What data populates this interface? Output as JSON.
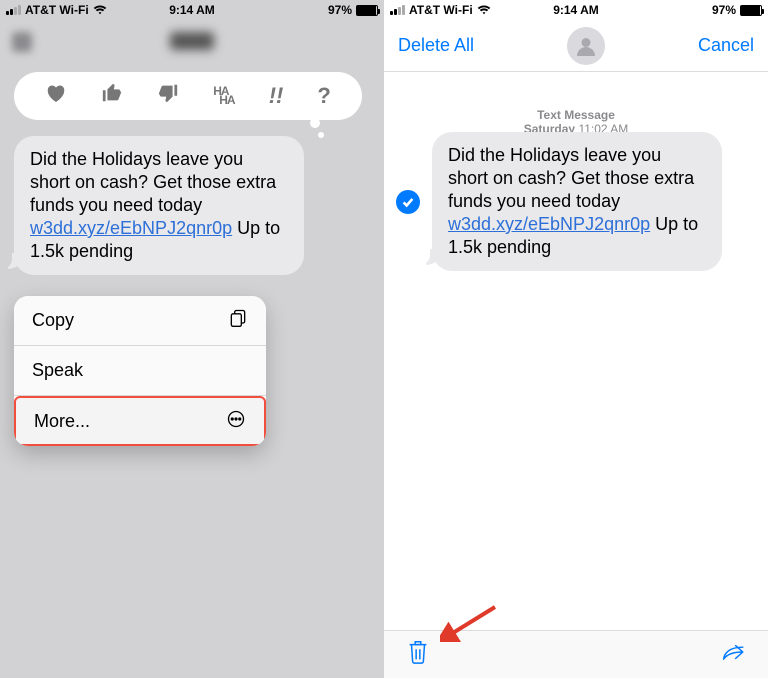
{
  "status": {
    "carrier": "AT&T Wi-Fi",
    "time": "9:14 AM",
    "battery_pct": "97%"
  },
  "message": {
    "text_before_link": "Did the Holidays leave you short on cash? Get those extra funds you need today ",
    "link": "w3dd.xyz/eEbNPJ2qnr0p",
    "text_after_link": " Up to 1.5k pending"
  },
  "tapback": {
    "heart": "♥",
    "thumbs_up": "👍",
    "thumbs_down": "👎",
    "haha_top": "HA",
    "haha_bottom": "HA",
    "exclaim": "!!",
    "question": "?"
  },
  "action_menu": {
    "copy": "Copy",
    "speak": "Speak",
    "more": "More..."
  },
  "right_nav": {
    "delete_all": "Delete All",
    "cancel": "Cancel"
  },
  "msg_meta": {
    "label": "Text Message",
    "day": "Saturday",
    "time": "11:02 AM"
  }
}
